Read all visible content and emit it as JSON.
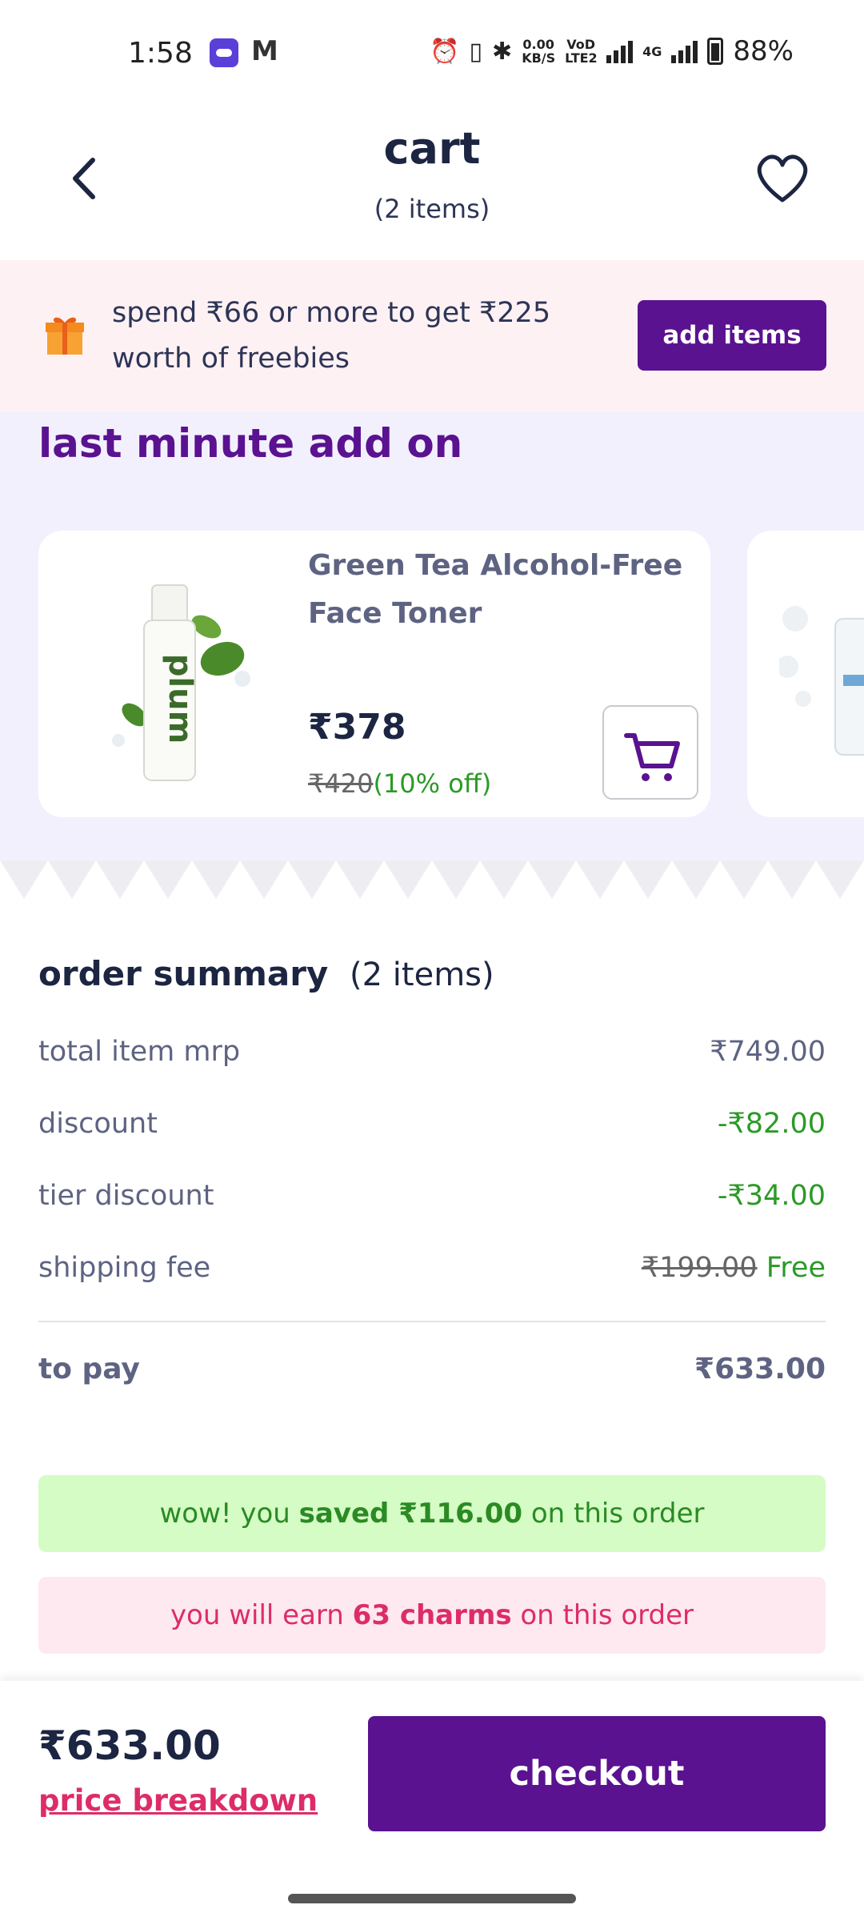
{
  "status_bar": {
    "time": "1:58",
    "mail_glyph": "M",
    "net_speed_value": "0.00",
    "net_speed_unit": "KB/S",
    "volte": "VoD LTE2",
    "network": "4G",
    "battery": "88%"
  },
  "header": {
    "title": "cart",
    "subtitle": "(2 items)"
  },
  "freebie_banner": {
    "text": "spend ₹66 or more to get ₹225 worth of freebies",
    "button_label": "add items"
  },
  "addon": {
    "title": "last minute add on",
    "cards": [
      {
        "name": "Green Tea Alcohol-Free Face Toner",
        "price": "₹378",
        "mrp": "₹420",
        "discount": "(10% off)"
      }
    ]
  },
  "order_summary": {
    "title": "order summary",
    "count": "(2 items)",
    "rows": [
      {
        "label": "total item mrp",
        "value": "₹749.00"
      },
      {
        "label": "discount",
        "value": "-₹82.00"
      },
      {
        "label": "tier discount",
        "value": "-₹34.00"
      },
      {
        "label": "shipping fee",
        "value_strike": "₹199.00",
        "value": "Free"
      }
    ],
    "to_pay_label": "to pay",
    "to_pay_value": "₹633.00"
  },
  "savings": {
    "prefix": "wow! you ",
    "highlight": "saved ₹116.00",
    "suffix": " on this order"
  },
  "charms": {
    "prefix": "you will earn ",
    "highlight": "63 charms",
    "suffix": " on this order"
  },
  "bottom_bar": {
    "total": "₹633.00",
    "price_breakdown_label": "price breakdown",
    "checkout_label": "checkout"
  },
  "colors": {
    "brand_purple": "#5a1290",
    "accent_pink": "#dd2c69",
    "success_green": "#2b9a26"
  }
}
